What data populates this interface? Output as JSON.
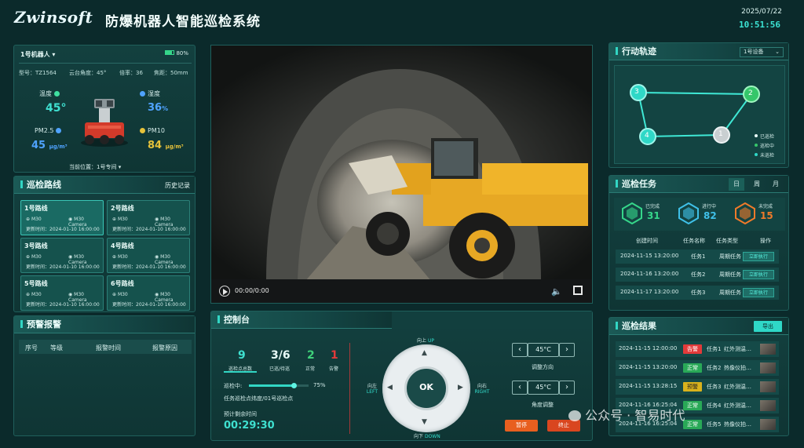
{
  "header": {
    "logo": "Zwinsoft",
    "title": "防爆机器人智能巡检系统",
    "date": "2025/07/22",
    "time": "10:51:56"
  },
  "robot": {
    "selector": "1号机器人",
    "battery": "80%",
    "battery_level": 0.8,
    "model_label": "型号：TZ1564",
    "pan_label": "云台角度：45°",
    "zoom_label": "倍率：36",
    "focus_label": "焦距：50mm",
    "temp_label": "温度",
    "temp_value": "45°",
    "humidity_label": "湿度",
    "humidity_value": "36",
    "humidity_unit": "%",
    "pm25_label": "PM2.5",
    "pm25_value": "45",
    "pm25_unit": "μg/m³",
    "pm10_label": "PM10",
    "pm10_value": "84",
    "pm10_unit": "μg/m³",
    "location_label": "当前位置：1号专间",
    "colors": {
      "temp": "#3fe0a0",
      "humidity": "#4fa3ff",
      "pm25": "#4fa3ff",
      "pm10": "#e6c23a"
    }
  },
  "routes": {
    "title": "巡检路线",
    "history": "历史记录",
    "items": [
      {
        "name": "1号路线",
        "device": "M30",
        "camera": "M30 Camera",
        "time": "更新时间：2024-01-10 16:00:00"
      },
      {
        "name": "2号路线",
        "device": "M30",
        "camera": "M30 Camera",
        "time": "更新时间：2024-01-10 16:00:00"
      },
      {
        "name": "3号路线",
        "device": "M30",
        "camera": "M30 Camera",
        "time": "更新时间：2024-01-10 16:00:00"
      },
      {
        "name": "4号路线",
        "device": "M30",
        "camera": "M30 Camera",
        "time": "更新时间：2024-01-10 16:00:00"
      },
      {
        "name": "5号路线",
        "device": "M30",
        "camera": "M30 Camera",
        "time": "更新时间：2024-01-10 16:00:00"
      },
      {
        "name": "6号路线",
        "device": "M30",
        "camera": "M30 Camera",
        "time": "更新时间：2024-01-10 16:00:00"
      }
    ]
  },
  "alarms": {
    "title": "预警报警",
    "columns": [
      "序号",
      "等级",
      "报警时间",
      "报警原因"
    ]
  },
  "video": {
    "time": "00:00/0:00"
  },
  "console": {
    "title": "控制台",
    "stats": [
      {
        "value": "9",
        "label": "巡检点总数",
        "color": "#3fe0d0"
      },
      {
        "value": "3/6",
        "label": "已巡/待巡",
        "color": "#e8fbf8"
      },
      {
        "value": "2",
        "label": "正常",
        "color": "#3fd17a"
      },
      {
        "value": "1",
        "label": "告警",
        "color": "#e23a3a"
      }
    ],
    "progress_label": "巡检中:",
    "progress_value": "75%",
    "progress": 0.75,
    "progress_desc": "任务巡检点纬度/01号巡检点",
    "remaining_label": "预计剩余时间",
    "remaining_time": "00:29:30",
    "dpad": {
      "ok": "OK",
      "up": "向上",
      "up_en": "UP",
      "down": "向下",
      "down_en": "DOWN",
      "left": "向左",
      "left_en": "LEFT",
      "right": "向右",
      "right_en": "RIGHT"
    },
    "direction_value": "45°C",
    "direction_label": "调整方向",
    "angle_value": "45°C",
    "angle_label": "角度调整",
    "pause_label": "暂停",
    "stop_label": "终止"
  },
  "track": {
    "title": "行动轨迹",
    "device": "1号设备",
    "nodes": [
      "3",
      "2",
      "4",
      "1"
    ],
    "legend": [
      "已巡检",
      "巡检中",
      "未巡检"
    ]
  },
  "tasks": {
    "title": "巡检任务",
    "tabs": [
      "日",
      "周",
      "月"
    ],
    "summary": [
      {
        "label": "已完成",
        "value": "31",
        "color": "#35d68a"
      },
      {
        "label": "进行中",
        "value": "82",
        "color": "#3fc0e8"
      },
      {
        "label": "未完成",
        "value": "15",
        "color": "#ef7a2a"
      }
    ],
    "columns": [
      "创建时间",
      "任务名称",
      "任务类型",
      "操作"
    ],
    "rows": [
      {
        "time": "2024-11-15 13:20:00",
        "name": "任务1",
        "type": "周期任务",
        "action": "立即执行"
      },
      {
        "time": "2024-11-16 13:20:00",
        "name": "任务2",
        "type": "周期任务",
        "action": "立即执行"
      },
      {
        "time": "2024-11-17 13:20:00",
        "name": "任务3",
        "type": "周期任务",
        "action": "立即执行"
      }
    ]
  },
  "results": {
    "title": "巡检结果",
    "export": "导出",
    "rows": [
      {
        "time": "2024-11-15 12:00:00",
        "status": "告警",
        "status_color": "red",
        "task": "任务1",
        "desc": "红外测温…"
      },
      {
        "time": "2024-11-15 13:20:00",
        "status": "正常",
        "status_color": "green",
        "task": "任务2",
        "desc": "热像仪拍…"
      },
      {
        "time": "2024-11-15 13:28:15",
        "status": "预警",
        "status_color": "yellow",
        "task": "任务3",
        "desc": "红外测温…"
      },
      {
        "time": "2024-11-16 16:25:04",
        "status": "正常",
        "status_color": "green",
        "task": "任务4",
        "desc": "红外测温…"
      },
      {
        "time": "2024-11-16 16:25:04",
        "status": "正常",
        "status_color": "green",
        "task": "任务5",
        "desc": "热像仪拍…"
      }
    ]
  },
  "watermark": "公众号 · 智易时代"
}
